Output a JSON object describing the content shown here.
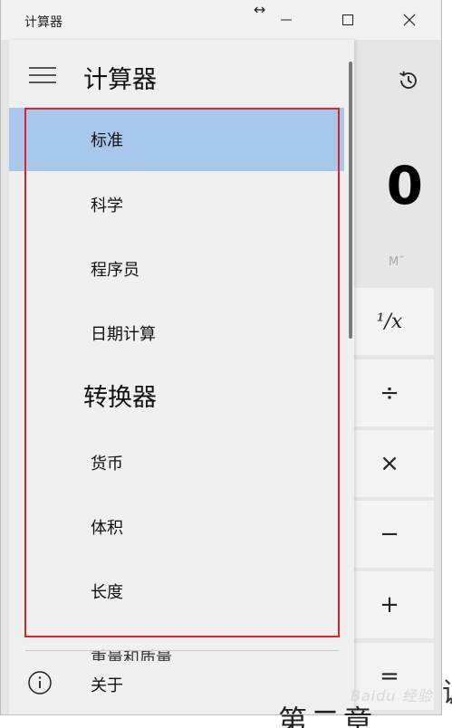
{
  "window": {
    "title": "计算器",
    "resize_glyph": "↔",
    "controls": [
      "minimize-icon",
      "maximize-icon",
      "close-icon"
    ]
  },
  "calculator": {
    "display_value": "0",
    "memory_label": "M˜",
    "keys": [
      {
        "name": "reciprocal",
        "label": "¹/x"
      },
      {
        "name": "divide",
        "label": "÷"
      },
      {
        "name": "multiply",
        "label": "×"
      },
      {
        "name": "subtract",
        "label": "−"
      },
      {
        "name": "add",
        "label": "+"
      },
      {
        "name": "equals",
        "label": "="
      }
    ]
  },
  "nav": {
    "title": "计算器",
    "items": [
      {
        "label": "标准",
        "selected": true
      },
      {
        "label": "科学"
      },
      {
        "label": "程序员"
      },
      {
        "label": "日期计算"
      }
    ],
    "converter_section": "转换器",
    "converter_items": [
      {
        "label": "货币"
      },
      {
        "label": "体积"
      },
      {
        "label": "长度"
      },
      {
        "label": "重量和质量"
      }
    ],
    "about_label": "关于"
  },
  "annotation": {
    "highlight_color": "#e0202a"
  },
  "colors": {
    "selected_item": "#a7c8ec",
    "nav_background": "#f0f0f0",
    "app_background": "#e6e6e6"
  },
  "background": {
    "partial_heading": "第二章",
    "partial_char": "调",
    "watermark": "Baidu 经验"
  }
}
